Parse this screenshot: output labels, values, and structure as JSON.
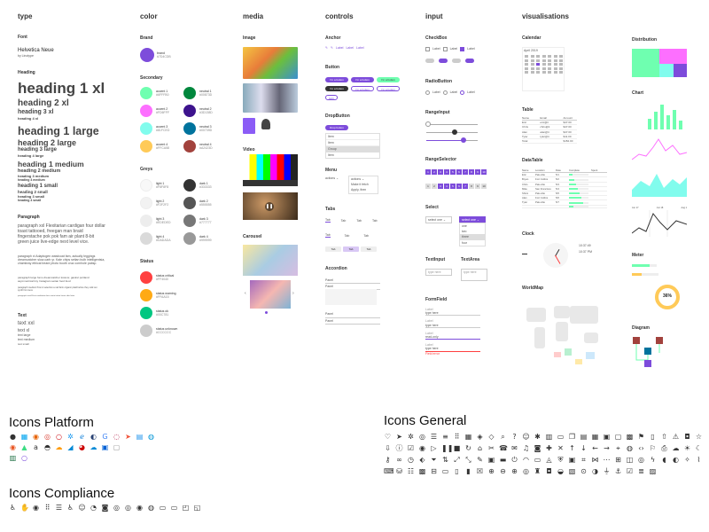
{
  "columns": {
    "type": "type",
    "color": "color",
    "media": "media",
    "controls": "controls",
    "input": "input",
    "visualisations": "visualisations"
  },
  "type": {
    "font_h": "Font",
    "font_name": "Helvetica Neue",
    "font_sub": "by Linotype",
    "heading_h": "Heading",
    "h1xl": "heading 1 xl",
    "h2xl": "heading 2 xl",
    "h3xl": "heading 3 xl",
    "h4xl": "heading 4 xl",
    "h1l": "heading 1 large",
    "h2l": "heading 2 large",
    "h3l": "heading 3 large",
    "h4l": "heading 4 large",
    "h1m": "heading 1 medium",
    "h2m": "heading 2 medium",
    "h3m": "heading 3 medium",
    "h4m": "heading 4 medium",
    "h1s": "heading 1 small",
    "h2s": "heading 2 small",
    "h3s": "heading 3 small",
    "h4s": "heading 4 small",
    "para_h": "Paragraph",
    "para_xl": "paragraph xxl Flexitarian cardigan four dollar toast tattooed, freegan man braid fingerstache pok pok fam air plant 8-bit green juice live-edge next level vice.",
    "para_l": "paragraph xl Adaptogen waistcoat fam, actually leggings dreamcatcher slow-carb yr. Kale chips seitan bulb intelligentsia, chambray ethical beard photo booth cruz cornhole pabsp.",
    "para_m": "paragraph large fomo dreamcatcher locavor, gastrel portland asymmetrical tiny Instagram seitan food food",
    "para_s": "paragraph medium Pour-it selection a nail farm organic plaid before they sold out synth hot mess",
    "para_xs": "paragraph small Fixie meditation beer meta tattoo lorem vibe letter",
    "text_h": "Text",
    "txxl": "text xxl",
    "txl": "text xl",
    "tl": "text large",
    "tm": "text medium",
    "ts": "text small"
  },
  "color": {
    "brand_h": "Brand",
    "brand": "brand",
    "brand_hex": "#7D4CDB",
    "secondary_h": "Secondary",
    "accent": [
      {
        "n": "accent 1",
        "h": "#6FFFB0"
      },
      {
        "n": "accent 2",
        "h": "#FD6FFF"
      },
      {
        "n": "accent 3",
        "h": "#81FCED"
      },
      {
        "n": "accent 4",
        "h": "#FFCA58"
      }
    ],
    "neutral": [
      {
        "n": "neutral 1",
        "h": "#00873D"
      },
      {
        "n": "neutral 2",
        "h": "#3D138D"
      },
      {
        "n": "neutral 3",
        "h": "#00739D"
      },
      {
        "n": "neutral 4",
        "h": "#A2423D"
      }
    ],
    "greys_h": "Greys",
    "light": [
      {
        "n": "light 1",
        "h": "#F8F8F8"
      },
      {
        "n": "light 2",
        "h": "#F2F2F2"
      },
      {
        "n": "light 3",
        "h": "#EDEDED"
      },
      {
        "n": "light 4",
        "h": "#DADADA"
      }
    ],
    "dark": [
      {
        "n": "dark 1",
        "h": "#333333"
      },
      {
        "n": "dark 2",
        "h": "#555555"
      },
      {
        "n": "dark 3",
        "h": "#777777"
      },
      {
        "n": "dark 4",
        "h": "#999999"
      }
    ],
    "status_h": "Status",
    "status": [
      {
        "n": "status critical",
        "h": "#FF4040"
      },
      {
        "n": "status warning",
        "h": "#FFAA15"
      },
      {
        "n": "status ok",
        "h": "#00C781"
      },
      {
        "n": "status unknown",
        "h": "#CCCCCC"
      }
    ]
  },
  "media": {
    "image_h": "Image",
    "video_h": "Video",
    "carousel_h": "Carousel"
  },
  "controls": {
    "anchor_h": "Anchor",
    "anchor_items": [
      "Label",
      "Label",
      "Label"
    ],
    "button_h": "Button",
    "buttons": [
      "I'm a button",
      "I'm a button",
      "I'm a button",
      "I'm a button",
      "I'm a button",
      "I'm a button"
    ],
    "edit": "Edit",
    "dropbutton_h": "DropButton",
    "drop_label": "Drop button",
    "drop_items": [
      "Item",
      "Item",
      "Group",
      "Item"
    ],
    "menu_h": "Menu",
    "menu_label": "actions",
    "menu_items": [
      "Make it fetch",
      "Apply, then"
    ],
    "tabs_h": "Tabs",
    "tab_items": [
      "Tab",
      "Tab",
      "Tab",
      "Tab"
    ],
    "accordion_h": "Accordion",
    "acc_items": [
      "Panel",
      "Panel",
      "Panel",
      "Panel"
    ]
  },
  "input": {
    "checkbox_h": "CheckBox",
    "cb_label": "Label",
    "radio_h": "RadioButton",
    "radio_label": "Label",
    "range_h": "RangeInput",
    "rangesel_h": "RangeSelector",
    "range_vals": [
      1,
      2,
      3,
      4,
      5,
      6,
      7,
      8,
      9,
      10
    ],
    "select_h": "Select",
    "select_val": "select one",
    "select_opts": [
      "one",
      "two",
      "three",
      "four"
    ],
    "textinput_h": "TextInput",
    "textarea_h": "TextArea",
    "text_ph": "type here",
    "form_h": "FormField",
    "form_labels": [
      "Label",
      "Label",
      "Label",
      "Label"
    ],
    "form_vals": [
      "type here",
      "type here",
      "read-only",
      "type here"
    ],
    "form_err": "Field error"
  },
  "vis": {
    "calendar_h": "Calendar",
    "cal_month": "April 2019",
    "table_h": "Table",
    "datatable_h": "DataTable",
    "clock_h": "Clock",
    "clock_time": "10:37:49",
    "clock_time2": "10:37 PM",
    "worldmap_h": "WorldMap",
    "distribution_h": "Distribution",
    "chart_h": "Chart",
    "meter_h": "Meter",
    "meter_val": "36%",
    "diagram_h": "Diagram",
    "table_head": [
      "Name",
      "Email",
      "Amount"
    ],
    "table_rows": [
      [
        "Eric",
        "eric@it",
        "$47.00"
      ],
      [
        "Chris",
        "chris@it",
        "$47.00"
      ],
      [
        "Alan",
        "alan@it",
        "$47.00"
      ],
      [
        "Tyler",
        "tyler@it",
        "$11.00"
      ],
      [
        "Total",
        "",
        "$152.00"
      ]
    ],
    "dt_head": [
      "Name",
      "Location",
      "Date",
      "Complete",
      "Spent"
    ],
    "dt_rows": [
      [
        "Eric",
        "Palo Alto",
        "5/1",
        "",
        ""
      ],
      [
        "Bryan",
        "Fort Collins",
        "5/2",
        "",
        ""
      ],
      [
        "Chris",
        "Palo Alto",
        "5/3",
        "",
        ""
      ],
      [
        "Mike",
        "San Francisco",
        "5/4",
        "",
        ""
      ],
      [
        "Shimi",
        "Palo Alto",
        "5/5",
        "",
        ""
      ],
      [
        "Alan",
        "Fort Collins",
        "5/6",
        "",
        ""
      ],
      [
        "Tyler",
        "Palo Alto",
        "5/7",
        "",
        ""
      ],
      [
        "",
        "",
        "",
        "",
        ""
      ]
    ],
    "line_labels": [
      "Jun 17",
      "Jun 18",
      "Aug 1"
    ]
  },
  "icons": {
    "platform_h": "Icons Platform",
    "general_h": "Icons General",
    "compliance_h": "Icons Compliance"
  }
}
